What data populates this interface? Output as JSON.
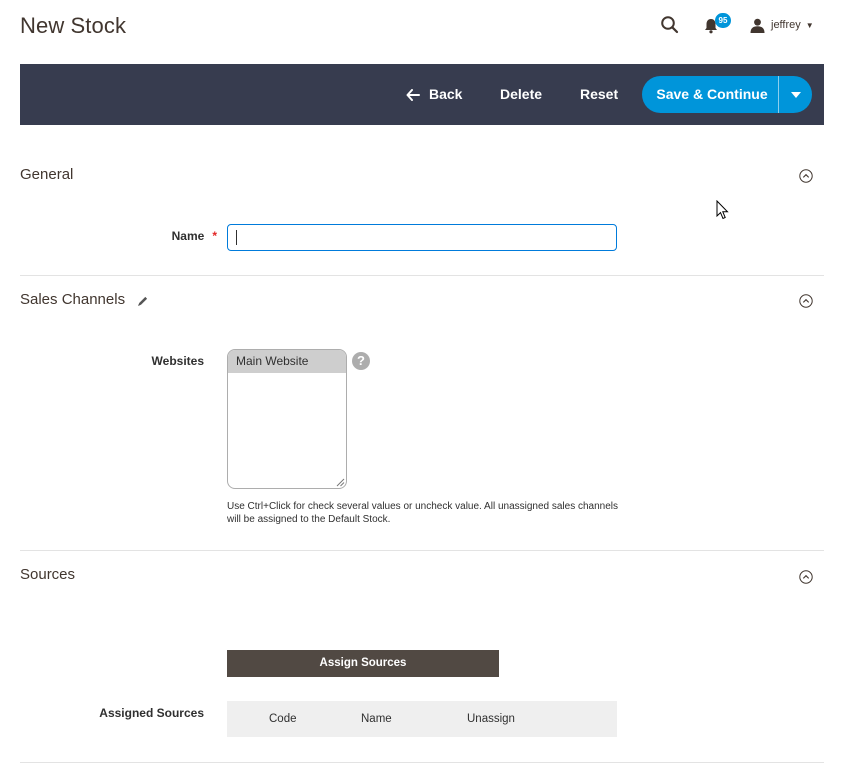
{
  "header": {
    "title": "New Stock",
    "notifications_count": "95",
    "username": "jeffrey",
    "icons": [
      "search-icon",
      "bell-icon",
      "user-icon",
      "caret-down-icon"
    ]
  },
  "toolbar": {
    "back_label": "Back",
    "delete_label": "Delete",
    "reset_label": "Reset",
    "save_label": "Save & Continue"
  },
  "sections": {
    "general": {
      "title": "General",
      "name_label": "Name",
      "name_required": "*",
      "name_value": ""
    },
    "sales_channels": {
      "title": "Sales Channels",
      "websites_label": "Websites",
      "websites_options": [
        "Main Website"
      ],
      "help": "?",
      "note": "Use Ctrl+Click for check several values or uncheck value. All unassigned sales channels will be assigned to the Default Stock."
    },
    "sources": {
      "title": "Sources",
      "assign_button": "Assign Sources",
      "assigned_label": "Assigned Sources",
      "columns": [
        "Code",
        "Name",
        "Unassign"
      ]
    }
  },
  "colors": {
    "toolbar_bg": "#373c4f",
    "primary": "#0095da",
    "assign_btn": "#514943",
    "focus_border": "#007bdb",
    "required": "#e22626"
  }
}
